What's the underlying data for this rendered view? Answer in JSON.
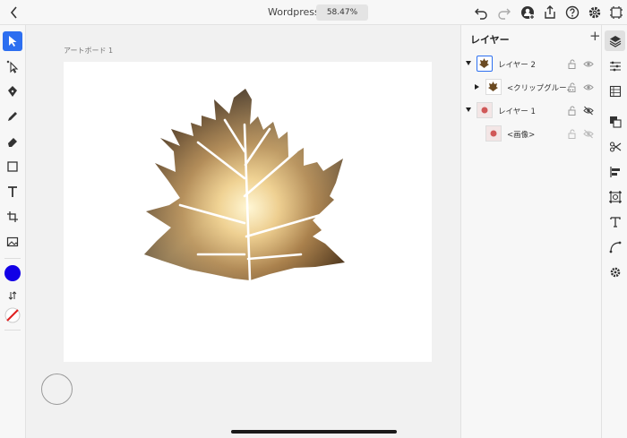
{
  "header": {
    "title": "Wordpress",
    "zoom": "58.47%"
  },
  "canvas": {
    "artboard_label": "アートボード 1"
  },
  "colors": {
    "accent": "#2d6ff0",
    "fill": "#1200e6",
    "stroke": "#e02020"
  },
  "layers_panel": {
    "title": "レイヤー",
    "add_label": "+",
    "layers": [
      {
        "name": "レイヤー 2",
        "expanded": true,
        "selected": true
      },
      {
        "name": "<クリップグルー…",
        "expanded": false
      },
      {
        "name": "レイヤー 1",
        "expanded": true,
        "hidden": true
      },
      {
        "name": "<画像>",
        "hidden": true
      }
    ]
  }
}
